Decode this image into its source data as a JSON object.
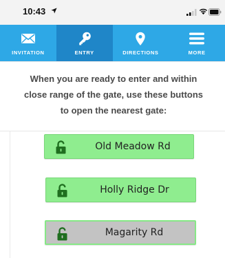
{
  "status_bar": {
    "time": "10:43",
    "location_icon": "location-arrow-icon",
    "signal_icon": "cellular-signal-icon",
    "wifi_icon": "wifi-icon",
    "battery_icon": "battery-icon"
  },
  "tabs": [
    {
      "label": "INVITATION",
      "icon": "envelope-icon",
      "active": false
    },
    {
      "label": "ENTRY",
      "icon": "key-icon",
      "active": true
    },
    {
      "label": "DIRECTIONS",
      "icon": "map-pin-icon",
      "active": false
    },
    {
      "label": "MORE",
      "icon": "hamburger-menu-icon",
      "active": false
    }
  ],
  "instruction": "When you are ready to enter and within close range of the gate, use these buttons to open the nearest gate:",
  "gates": [
    {
      "label": "Old Meadow Rd",
      "icon": "unlock-icon",
      "state": "enabled"
    },
    {
      "label": "Holly Ridge Dr",
      "icon": "unlock-icon",
      "state": "enabled"
    },
    {
      "label": "Magarity Rd",
      "icon": "unlock-icon",
      "state": "disabled"
    }
  ],
  "colors": {
    "tab_bar": "#2ea8e6",
    "tab_active": "#1f86c8",
    "gate_button": "#8fed8f",
    "gate_button_disabled": "#c3c3c3",
    "lock_icon": "#1f6e1f"
  }
}
